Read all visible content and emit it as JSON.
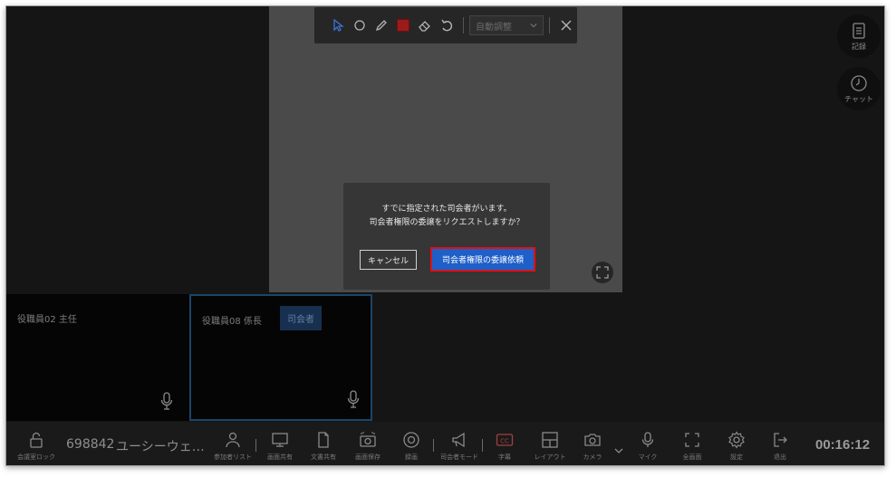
{
  "annotation_toolbar": {
    "zoom_select_value": "自動調整",
    "tools": [
      "pointer-icon",
      "circle-icon",
      "pencil-icon",
      "color-swatch",
      "eraser-icon",
      "undo-icon"
    ],
    "active_color": "#9b1b1b"
  },
  "side_buttons": {
    "record_label": "記録",
    "chat_label": "チャット"
  },
  "dialog": {
    "message_line1": "すでに指定された司会者がいます。",
    "message_line2": "司会者権限の委譲をリクエストしますか？",
    "cancel_label": "キャンセル",
    "request_label": "司会者権限の委譲依頼"
  },
  "participants": [
    {
      "name": "役職員02  主任",
      "is_host": false
    },
    {
      "name": "役職員08  係長",
      "is_host": true,
      "host_badge": "司会者"
    }
  ],
  "bottom_bar": {
    "lock_label": "会議室ロック",
    "meeting_id": "698842",
    "meeting_name": "ユーシーウェ…",
    "items": {
      "participants": "参加者リスト",
      "screen_share": "画面共有",
      "doc_share": "文書共有",
      "screenshot": "画面保存",
      "recording": "録画",
      "host_mode": "司会者モード",
      "captions": "字幕",
      "layout": "レイアウト",
      "camera": "カメラ",
      "mic": "マイク",
      "fullscreen": "全画面",
      "settings": "設定",
      "exit": "退出"
    },
    "timer": "00:16:12"
  },
  "colors": {
    "accent_blue": "#1e5fc8",
    "highlight_red": "#e0101a",
    "bar_bg": "#1a1a1a"
  }
}
